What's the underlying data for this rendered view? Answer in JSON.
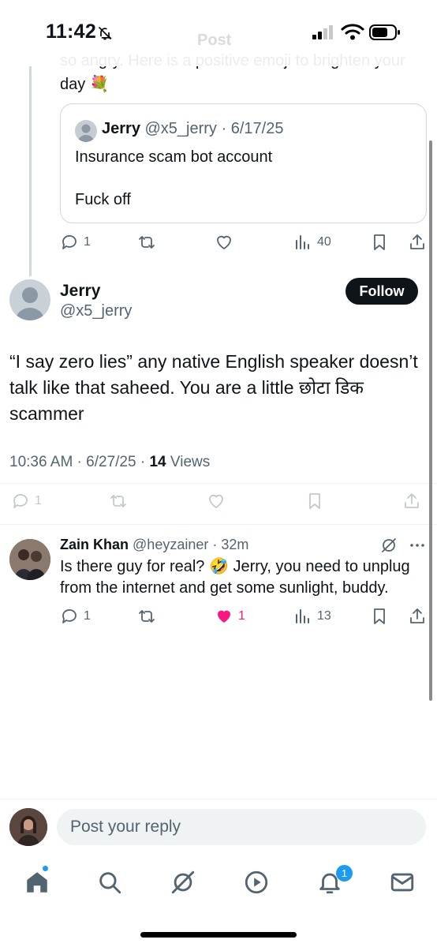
{
  "status_bar": {
    "time": "11:42"
  },
  "header": {
    "title": "Post"
  },
  "parent_tweet": {
    "text_cut": "so angry. Here is a positive emoji to brighten your day 💐",
    "quote": {
      "name": "Jerry",
      "handle": "@x5_jerry",
      "date": "6/17/25",
      "line1": "Insurance scam bot account",
      "line2": "Fuck off"
    },
    "actions": {
      "replies": "1",
      "views": "40"
    }
  },
  "main_tweet": {
    "name": "Jerry",
    "handle": "@x5_jerry",
    "follow_label": "Follow",
    "text": "“I say zero lies” any native English speaker doesn’t talk like that saheed. You are a little छोटा डिक scammer",
    "time": "10:36 AM",
    "date": "6/27/25",
    "views_count": "14",
    "views_label": "Views",
    "actions": {
      "replies": "1"
    }
  },
  "reply": {
    "name": "Zain Khan",
    "handle": "@heyzainer",
    "age": "32m",
    "text": "Is there guy for real? 🤣 Jerry, you need to unplug from the internet and get some sunlight, buddy.",
    "actions": {
      "replies": "1",
      "likes": "1",
      "views": "13"
    }
  },
  "compose": {
    "placeholder": "Post your reply"
  },
  "tab_bar": {
    "notifications_badge": "1"
  },
  "colors": {
    "accent": "#1d9bf0",
    "like": "#f91880",
    "text": "#0f1419",
    "muted": "#536471"
  }
}
